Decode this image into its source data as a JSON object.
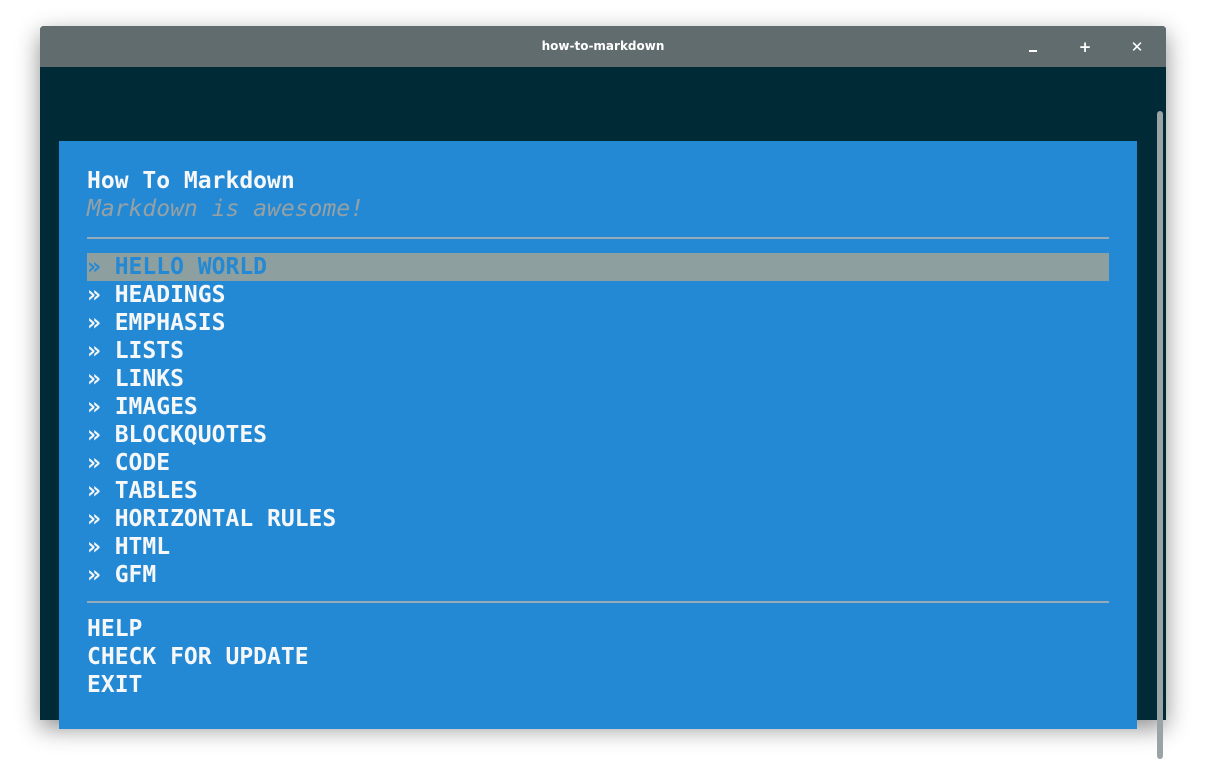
{
  "window": {
    "title": "how-to-markdown",
    "controls": {
      "minimize": "minimize-icon",
      "maximize": "+",
      "close": "✕"
    }
  },
  "app": {
    "title": "How To Markdown",
    "subtitle": "Markdown is awesome!"
  },
  "menu": {
    "selected_index": 0,
    "items": [
      {
        "label": "» HELLO WORLD"
      },
      {
        "label": "» HEADINGS"
      },
      {
        "label": "» EMPHASIS"
      },
      {
        "label": "» LISTS"
      },
      {
        "label": "» LINKS"
      },
      {
        "label": "» IMAGES"
      },
      {
        "label": "» BLOCKQUOTES"
      },
      {
        "label": "» CODE"
      },
      {
        "label": "» TABLES"
      },
      {
        "label": "» HORIZONTAL RULES"
      },
      {
        "label": "» HTML"
      },
      {
        "label": "» GFM"
      }
    ]
  },
  "actions": {
    "items": [
      {
        "label": "HELP"
      },
      {
        "label": "CHECK FOR UPDATE"
      },
      {
        "label": "EXIT"
      }
    ]
  },
  "colors": {
    "titlebar": "#616c6f",
    "terminal_bg": "#002a36",
    "panel_bg": "#2489d4",
    "text": "#f5f7f9",
    "subtitle": "#95a1a4",
    "selection_bg": "#8e9fa0"
  }
}
